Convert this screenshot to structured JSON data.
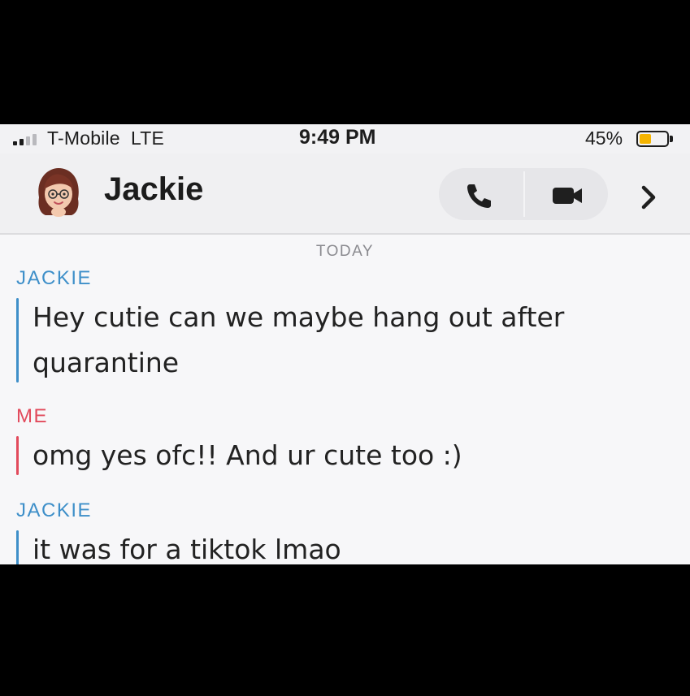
{
  "status_bar": {
    "carrier": "T-Mobile",
    "network": "LTE",
    "time": "9:49 PM",
    "battery_percent_label": "45%",
    "battery_level": 0.45,
    "battery_color": "#f5b400",
    "signal_bars_active": 2,
    "signal_bars_total": 4
  },
  "header": {
    "contact_name": "Jackie",
    "avatar_icon": "bitmoji-avatar",
    "call_icon": "phone-icon",
    "video_icon": "video-camera-icon",
    "chevron_icon": "chevron-right-icon"
  },
  "chat": {
    "day_separator": "TODAY",
    "messages": [
      {
        "sender": "JACKIE",
        "text": "Hey cutie can we maybe hang out after quarantine"
      },
      {
        "sender": "ME",
        "text": "omg yes ofc!! And ur cute too :)"
      },
      {
        "sender": "JACKIE",
        "text": "it was for a tiktok lmao"
      }
    ]
  },
  "colors": {
    "jackie_accent": "#3e8fc9",
    "me_accent": "#e24a5c"
  }
}
